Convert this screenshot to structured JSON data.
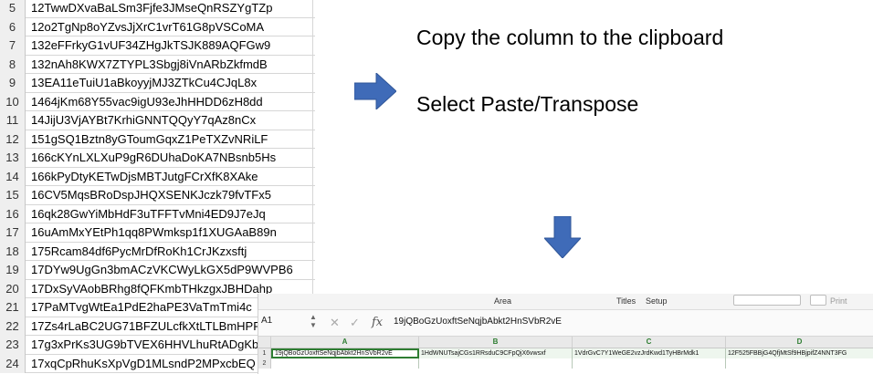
{
  "left_sheet": {
    "rows": [
      {
        "num": "5",
        "value": "12TwwDXvaBaLSm3Fjfe3JMseQnRSZYgTZp"
      },
      {
        "num": "6",
        "value": "12o2TgNp8oYZvsJjXrC1vrT61G8pVSCoMA"
      },
      {
        "num": "7",
        "value": "132eFFrkyG1vUF34ZHgJkTSJK889AQFGw9"
      },
      {
        "num": "8",
        "value": "132nAh8KWX7ZTYPL3Sbgj8iVnARbZkfmdB"
      },
      {
        "num": "9",
        "value": "13EA11eTuiU1aBkoyyjMJ3ZTkCu4CJqL8x"
      },
      {
        "num": "10",
        "value": "1464jKm68Y55vac9igU93eJhHHDD6zH8dd"
      },
      {
        "num": "11",
        "value": "14JijU3VjAYBt7KrhiGNNTQQyY7qAz8nCx"
      },
      {
        "num": "12",
        "value": "151gSQ1Bztn8yGToumGqxZ1PeTXZvNRiLF"
      },
      {
        "num": "13",
        "value": "166cKYnLXLXuP9gR6DUhaDoKA7NBsnb5Hs"
      },
      {
        "num": "14",
        "value": "166kPyDtyKETwDjsMBTJutgFCrXfK8XAke"
      },
      {
        "num": "15",
        "value": "16CV5MqsBRoDspJHQXSENKJczk79fvTFx5"
      },
      {
        "num": "16",
        "value": "16qk28GwYiMbHdF3uTFFTvMni4ED9J7eJq"
      },
      {
        "num": "17",
        "value": "16uAmMxYEtPh1qq8PWmksp1f1XUGAaB89n"
      },
      {
        "num": "18",
        "value": "175Rcam84df6PycMrDfRoKh1CrJKzxsftj"
      },
      {
        "num": "19",
        "value": "17DYw9UgGn3bmACzVKCWyLkGX5dP9WVPB6"
      },
      {
        "num": "20",
        "value": "17DxSyVAobBRhg8fQFKmbTHkzgxJBHDahp"
      },
      {
        "num": "21",
        "value": "17PaMTvgWtEa1PdE2haPE3VaTmTmi4c"
      },
      {
        "num": "22",
        "value": "17Zs4rLaBC2UG71BFZULcfkXtLTLBmHPP"
      },
      {
        "num": "23",
        "value": "17g3xPrKs3UG9bTVEX6HHVLhuRtADgKb"
      },
      {
        "num": "24",
        "value": "17xqCpRhuKsXpVgD1MLsndP2MPxcbEQ"
      }
    ]
  },
  "instructions": {
    "step1": "Copy the column to the clipboard",
    "step2": "Select Paste/Transpose"
  },
  "bottom_sheet": {
    "ribbon": {
      "area": "Area",
      "titles": "Titles",
      "setup": "Setup",
      "print": "Print"
    },
    "name_box": "A1",
    "formula_value": "19jQBoGzUoxftSeNqjbAbkt2HnSVbR2vE",
    "columns": [
      "A",
      "B",
      "C",
      "D"
    ],
    "rows": [
      {
        "num": "1",
        "cells": [
          "19jQBoGzUoxftSeNqjbAbkt2HnSVbR2vE",
          "1HdWNUTsajCGs1RRsduC9CFpQjX6vwsxf",
          "1VdrGvC7Y1WeGE2vzJrdKwd1TyHBrMdk1",
          "12F525FBBjG4QfjMtSf9HBjpifZ4NNT3FG"
        ]
      },
      {
        "num": "2",
        "cells": [
          "",
          "",
          "",
          ""
        ]
      }
    ]
  },
  "colors": {
    "arrow": "#3f6bb8",
    "selection": "#2e7d32"
  }
}
